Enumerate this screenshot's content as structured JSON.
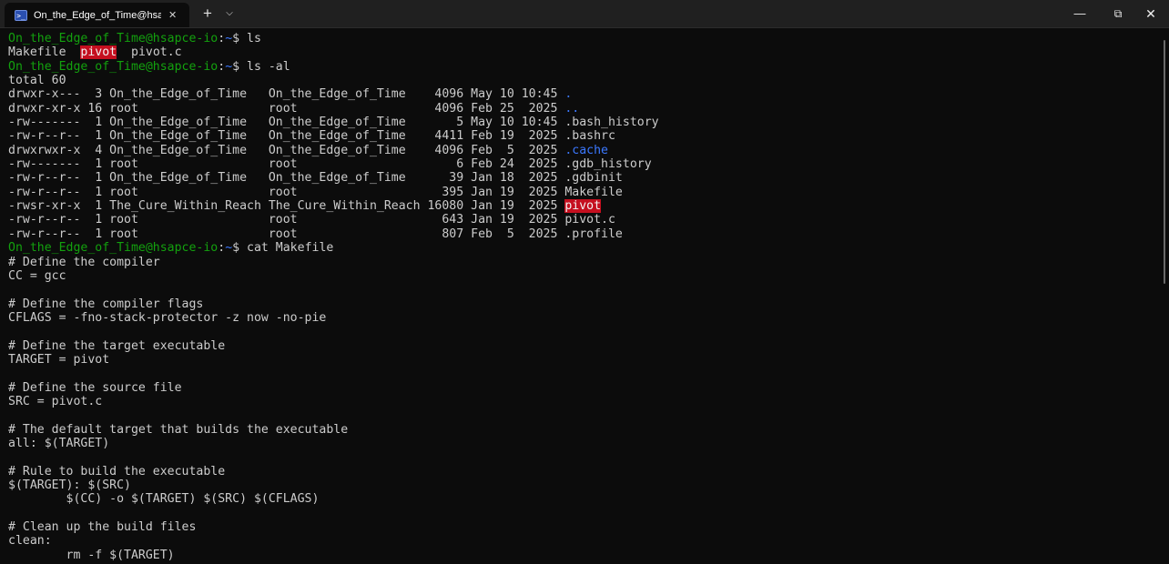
{
  "tab": {
    "title": "On_the_Edge_of_Time@hsapce-io: ~",
    "icon": "powershell-icon",
    "close_symbol": "✕"
  },
  "titlebar": {
    "new_tab_symbol": "+",
    "dropdown_symbol": "⌵",
    "minimize_symbol": "—",
    "maximize_symbol": "⧉",
    "close_symbol": "✕"
  },
  "colors": {
    "prompt_user": "#13a10e",
    "prompt_path": "#3b78ff",
    "setuid_highlight": "#c50f1f",
    "text": "#cccccc",
    "background": "#0c0c0c"
  },
  "prompt": {
    "user_host": "On_the_Edge_of_Time@hsapce-io",
    "path": "~"
  },
  "cmd1": "ls",
  "ls_out": {
    "f1": "Makefile",
    "f2": "pivot",
    "f3": "pivot.c"
  },
  "cmd2": "ls -al",
  "total": "total 60",
  "listing": [
    {
      "prefix": "drwxr-x---  3 On_the_Edge_of_Time   On_the_Edge_of_Time    4096 May 10 10:45 ",
      "name": "."
    },
    {
      "prefix": "drwxr-xr-x 16 root                  root                   4096 Feb 25  2025 ",
      "name": ".."
    },
    {
      "prefix": "-rw-------  1 On_the_Edge_of_Time   On_the_Edge_of_Time       5 May 10 10:45 ",
      "name": ".bash_history"
    },
    {
      "prefix": "-rw-r--r--  1 On_the_Edge_of_Time   On_the_Edge_of_Time    4411 Feb 19  2025 ",
      "name": ".bashrc"
    },
    {
      "prefix": "drwxrwxr-x  4 On_the_Edge_of_Time   On_the_Edge_of_Time    4096 Feb  5  2025 ",
      "name": ".cache"
    },
    {
      "prefix": "-rw-------  1 root                  root                      6 Feb 24  2025 ",
      "name": ".gdb_history"
    },
    {
      "prefix": "-rw-r--r--  1 On_the_Edge_of_Time   On_the_Edge_of_Time      39 Jan 18  2025 ",
      "name": ".gdbinit"
    },
    {
      "prefix": "-rw-r--r--  1 root                  root                    395 Jan 19  2025 ",
      "name": "Makefile"
    },
    {
      "prefix": "-rwsr-xr-x  1 The_Cure_Within_Reach The_Cure_Within_Reach 16080 Jan 19  2025 ",
      "name": "pivot"
    },
    {
      "prefix": "-rw-r--r--  1 root                  root                    643 Jan 19  2025 ",
      "name": "pivot.c"
    },
    {
      "prefix": "-rw-r--r--  1 root                  root                    807 Feb  5  2025 ",
      "name": ".profile"
    }
  ],
  "cmd3": "cat Makefile",
  "makefile": [
    "# Define the compiler",
    "CC = gcc",
    "",
    "# Define the compiler flags",
    "CFLAGS = -fno-stack-protector -z now -no-pie",
    "",
    "# Define the target executable",
    "TARGET = pivot",
    "",
    "# Define the source file",
    "SRC = pivot.c",
    "",
    "# The default target that builds the executable",
    "all: $(TARGET)",
    "",
    "# Rule to build the executable",
    "$(TARGET): $(SRC)",
    "        $(CC) -o $(TARGET) $(SRC) $(CFLAGS)",
    "",
    "# Clean up the build files",
    "clean:",
    "        rm -f $(TARGET)"
  ]
}
